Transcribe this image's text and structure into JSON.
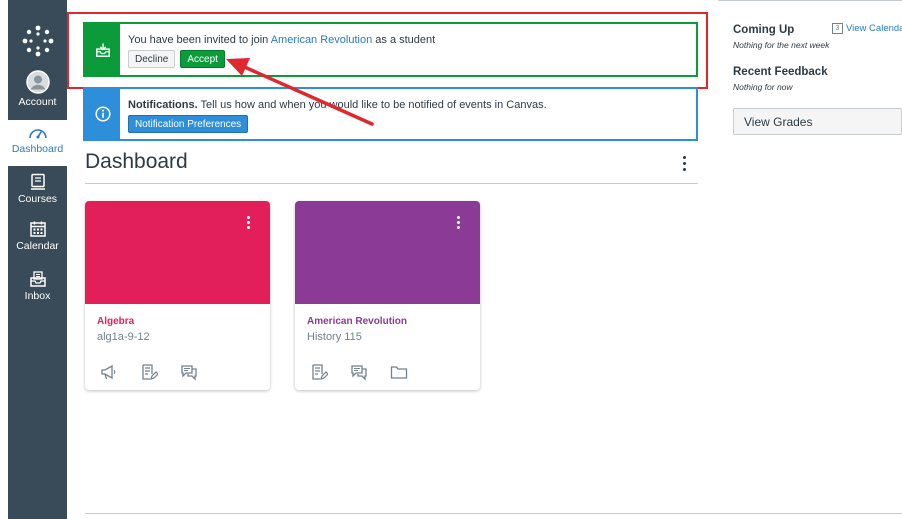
{
  "nav": {
    "logo_icon": "canvas-logo-icon",
    "items": [
      {
        "label": "Account",
        "icon": "user-avatar-icon"
      },
      {
        "label": "Dashboard",
        "icon": "speedometer-icon",
        "active": true
      },
      {
        "label": "Courses",
        "icon": "book-icon"
      },
      {
        "label": "Calendar",
        "icon": "calendar-icon"
      },
      {
        "label": "Inbox",
        "icon": "inbox-icon"
      }
    ]
  },
  "invitation": {
    "text_before": "You have been invited to join ",
    "course_link": "American Revolution",
    "text_after": " as a student",
    "decline_label": "Decline",
    "accept_label": "Accept",
    "icon": "inbox-icon"
  },
  "notification": {
    "title": "Notifications.",
    "message": " Tell us how and when you would like to be notified of events in Canvas.",
    "button_label": "Notification Preferences",
    "icon": "info-icon"
  },
  "dashboard": {
    "title": "Dashboard",
    "cards": [
      {
        "name": "Algebra",
        "code": "alg1a-9-12",
        "color": "#e21f5b",
        "actions": [
          "announcements-icon",
          "assignments-icon",
          "discussions-icon"
        ]
      },
      {
        "name": "American Revolution",
        "code": "History 115",
        "color": "#8b3a96",
        "actions": [
          "assignments-icon",
          "discussions-icon",
          "files-icon"
        ]
      }
    ]
  },
  "sidebar": {
    "coming_up_title": "Coming Up",
    "view_calendar_label": "View Calendar",
    "calendar_day": "3",
    "coming_up_empty": "Nothing for the next week",
    "feedback_title": "Recent Feedback",
    "feedback_empty": "Nothing for now",
    "view_grades_label": "View Grades"
  },
  "colors": {
    "nav_bg": "#394b58",
    "success": "#0b9b3a",
    "info": "#2d8ed9",
    "link": "#2b7abc",
    "annotation_red": "#e0272d"
  }
}
